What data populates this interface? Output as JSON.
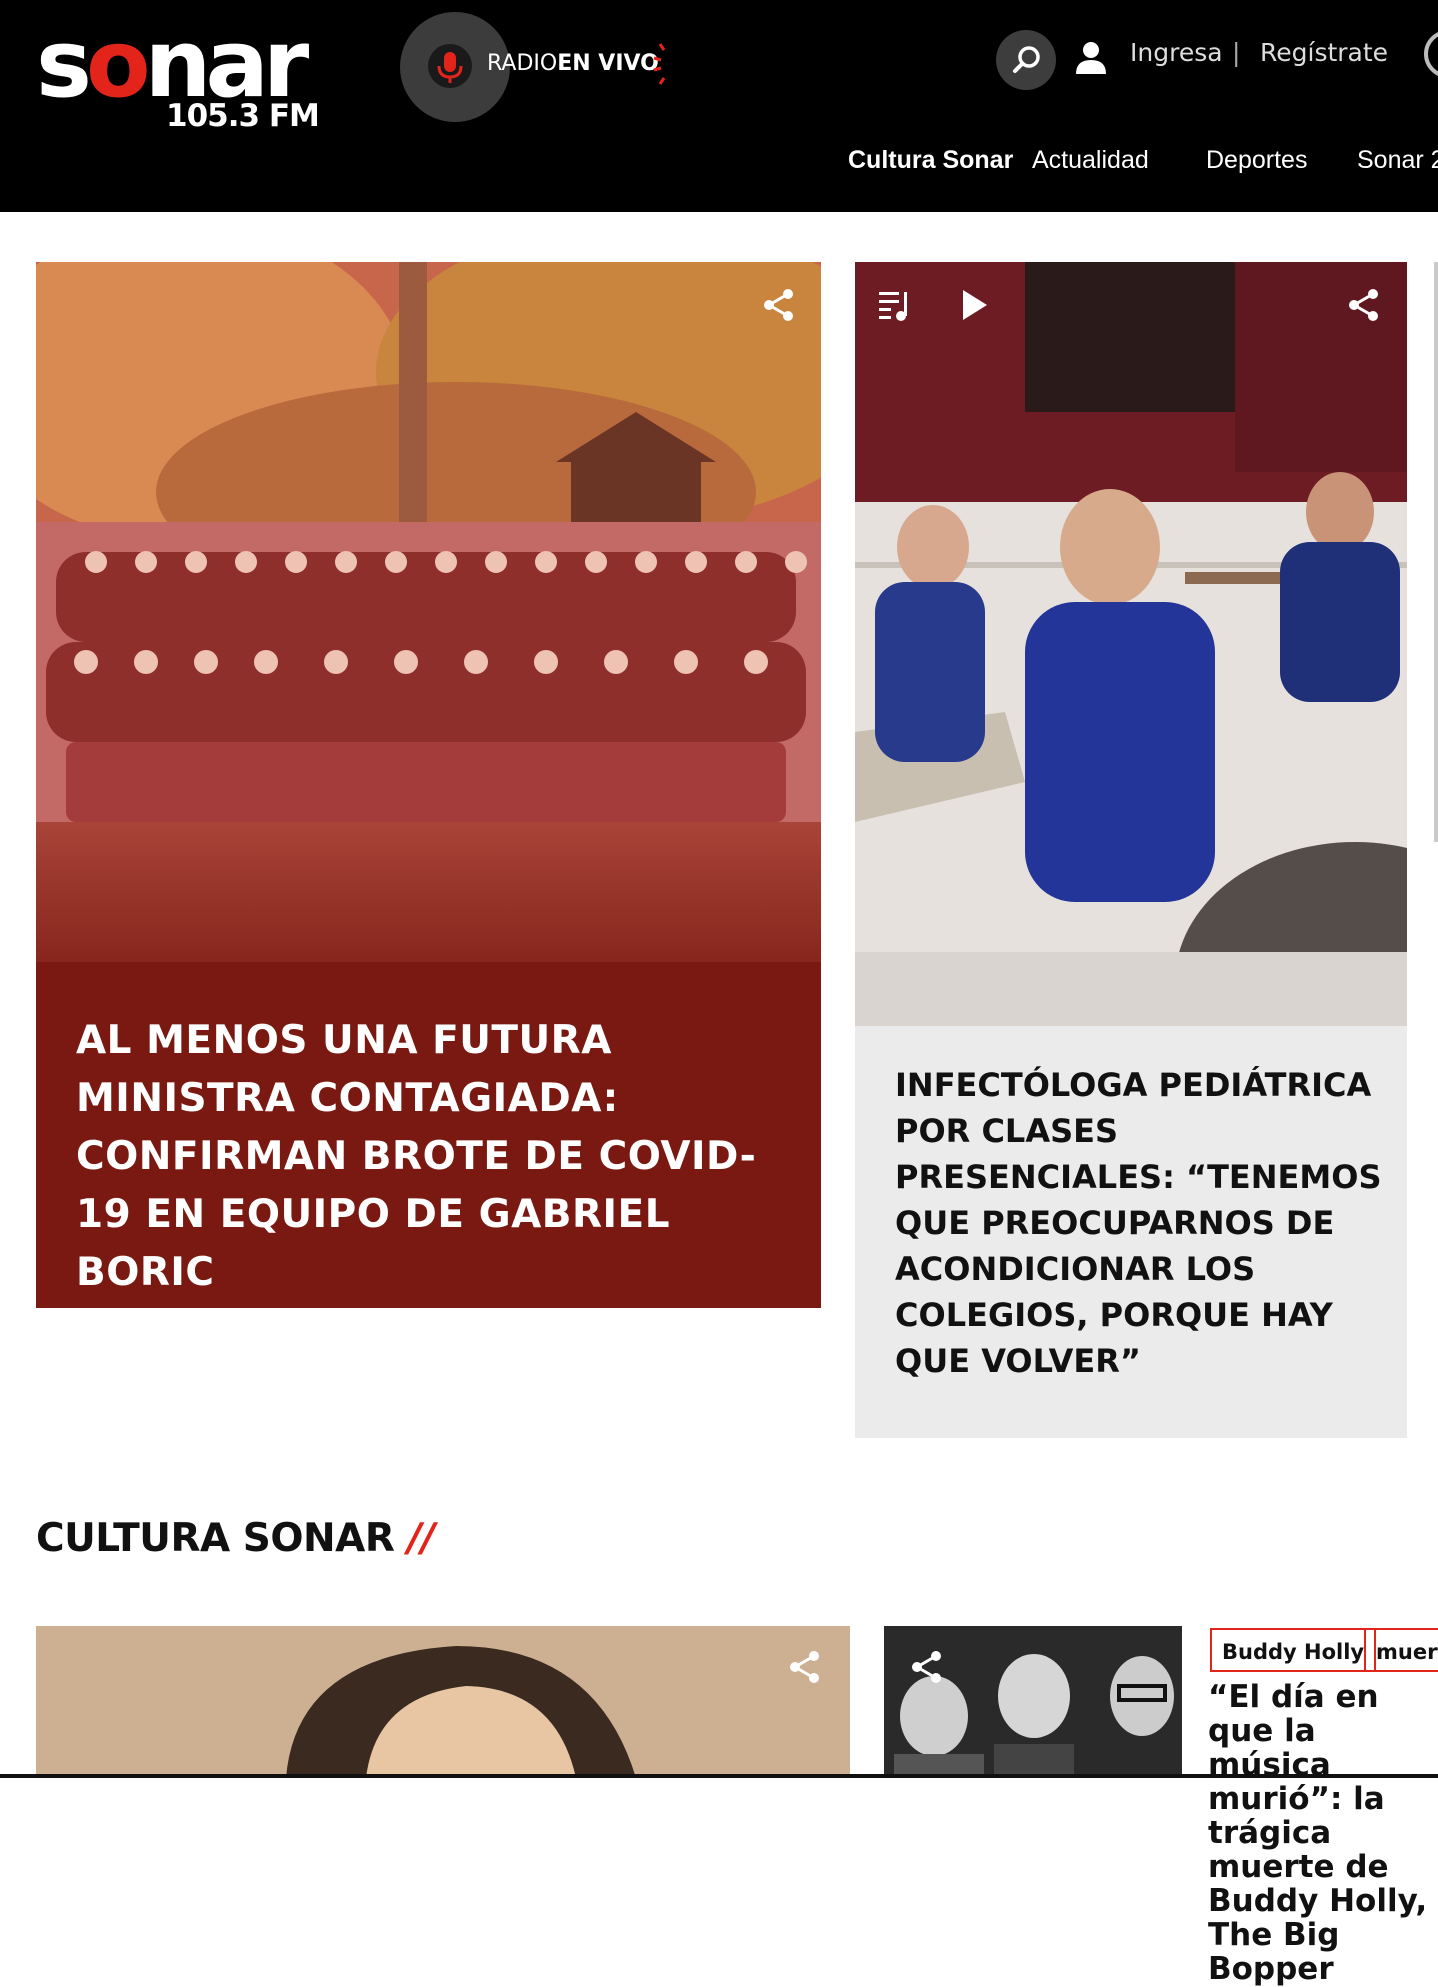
{
  "header": {
    "logo": {
      "part1": "s",
      "part2": "o",
      "part3": "n",
      "part4": "ar",
      "frequency": "105.3 FM"
    },
    "radio": {
      "label_light": "RADIO",
      "label_bold": "EN VIVO"
    },
    "login_label": "Ingresa",
    "divider": "|",
    "register_label": "Regístrate",
    "nav": [
      "Cultura Sonar",
      "Actualidad",
      "Deportes",
      "Sonar 2"
    ]
  },
  "featured": [
    {
      "title": "Al menos una futura ministra contagiada: Confirman brote de Covid-19 en equipo de Gabriel Boric"
    },
    {
      "title": "Infectóloga pediátrica por clases presenciales: “Tenemos que preocuparnos de acondicionar los colegios, porque hay que volver”"
    }
  ],
  "section": {
    "title": "CULTURA SONAR",
    "slashes": "//",
    "tags": [
      "Buddy Holly",
      "muerte"
    ],
    "card_title": "“El día en que la música murió”: la trágica muerte de Buddy Holly, The Big Bopper"
  },
  "colors": {
    "brand_red": "#e3241b",
    "featured_bg": "#7a1912",
    "card_bg": "#ebebeb"
  },
  "icons": [
    "search-icon",
    "user-icon",
    "microphone-icon",
    "share-icon",
    "playlist-icon",
    "play-icon"
  ]
}
